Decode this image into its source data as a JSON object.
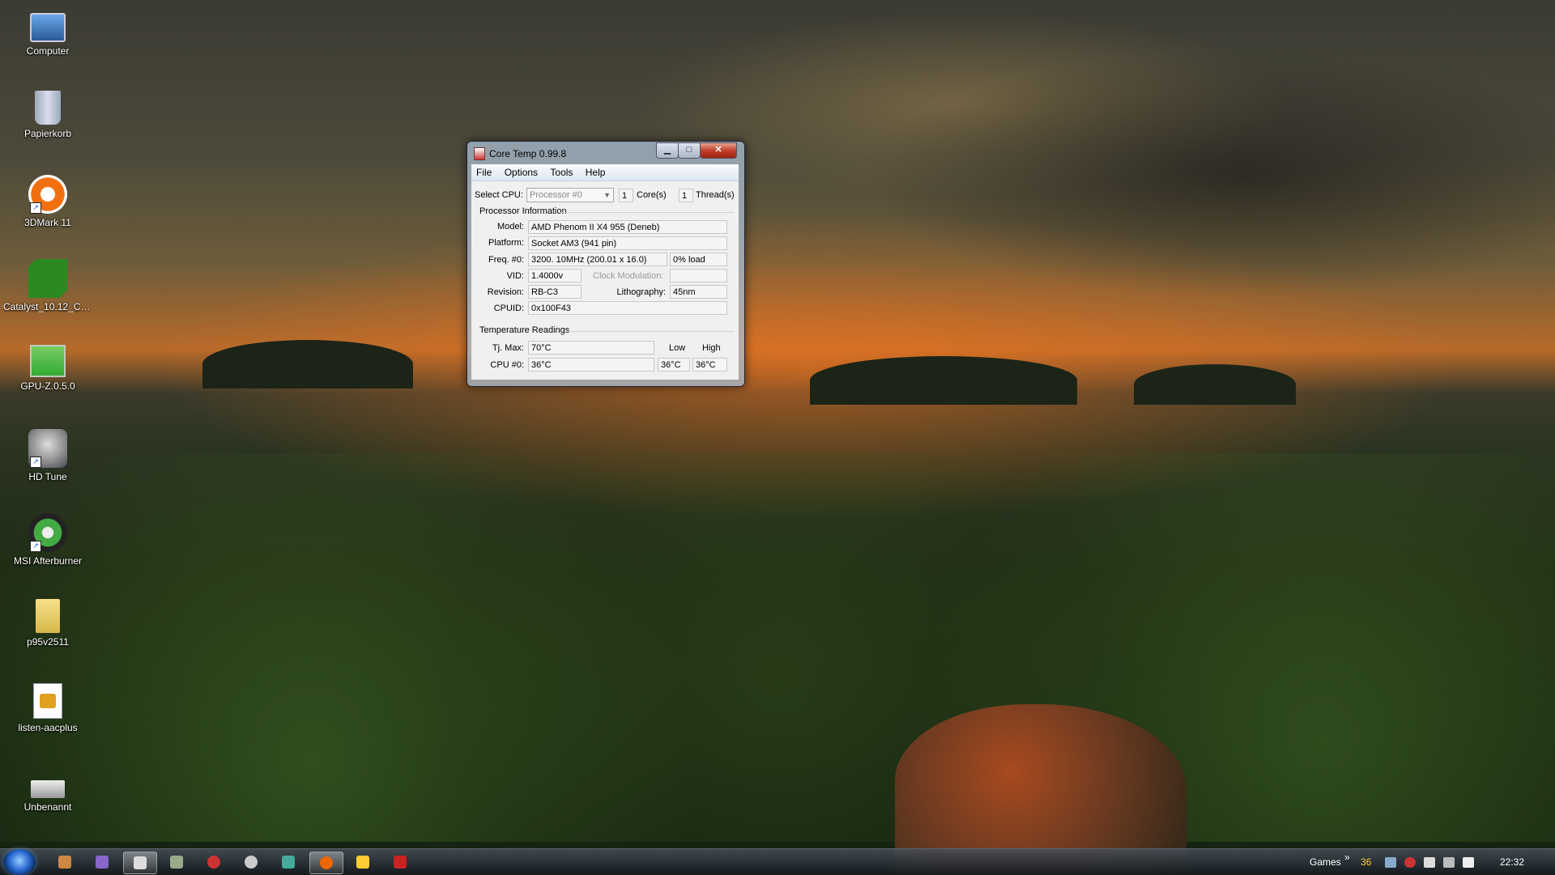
{
  "desktop": {
    "icons": [
      {
        "label": "Computer",
        "icon": "computer-icon"
      },
      {
        "label": "Papierkorb",
        "icon": "recycle-bin-icon"
      },
      {
        "label": "3DMark 11",
        "icon": "3dmark-icon"
      },
      {
        "label": "Catalyst_10.12_CCC...",
        "icon": "catalyst-icon"
      },
      {
        "label": "GPU-Z.0.5.0",
        "icon": "gpuz-icon"
      },
      {
        "label": "HD Tune",
        "icon": "hdtune-icon"
      },
      {
        "label": "MSI Afterburner",
        "icon": "msi-afterburner-icon"
      },
      {
        "label": "p95v2511",
        "icon": "folder-icon"
      },
      {
        "label": "listen-aacplus",
        "icon": "playlist-file-icon"
      },
      {
        "label": "Unbenannt",
        "icon": "drive-icon"
      }
    ]
  },
  "window": {
    "title": "Core Temp 0.99.8",
    "close_glyph": "✕",
    "menu": [
      "File",
      "Options",
      "Tools",
      "Help"
    ],
    "select_cpu_label": "Select CPU:",
    "cpu_selected": "Processor #0",
    "cores_value": "1",
    "cores_label": "Core(s)",
    "threads_value": "1",
    "threads_label": "Thread(s)",
    "processor_info_title": "Processor Information",
    "model_label": "Model:",
    "model_value": "AMD Phenom II X4 955 (Deneb)",
    "platform_label": "Platform:",
    "platform_value": "Socket AM3 (941 pin)",
    "freq_label": "Freq. #0:",
    "freq_value": "3200. 10MHz (200.01 x 16.0)",
    "load_value": "0% load",
    "vid_label": "VID:",
    "vid_value": "1.4000v",
    "clock_mod_label": "Clock Modulation:",
    "revision_label": "Revision:",
    "revision_value": "RB-C3",
    "litho_label": "Lithography:",
    "litho_value": "45nm",
    "cpuid_label": "CPUID:",
    "cpuid_value": "0x100F43",
    "temp_title": "Temperature Readings",
    "tjmax_label": "Tj. Max:",
    "tjmax_value": "70°C",
    "low_label": "Low",
    "high_label": "High",
    "cpu0_label": "CPU #0:",
    "cpu0_value": "36°C",
    "cpu0_low": "36°C",
    "cpu0_high": "36°C"
  },
  "taskbar": {
    "items": [
      {
        "icon": "start-orb-icon"
      },
      {
        "icon": "app-icon-1"
      },
      {
        "icon": "app-icon-z"
      },
      {
        "icon": "coretemp-taskbar-icon",
        "active": true
      },
      {
        "icon": "app-icon-4"
      },
      {
        "icon": "app-icon-5"
      },
      {
        "icon": "steam-icon"
      },
      {
        "icon": "app-icon-7"
      },
      {
        "icon": "firefox-icon",
        "active": true
      },
      {
        "icon": "app-icon-9"
      },
      {
        "icon": "app-icon-10"
      }
    ],
    "toolbar_label": "Games",
    "toolbar_chevron": "»",
    "tray_temp": "36",
    "clock": "22:32"
  }
}
